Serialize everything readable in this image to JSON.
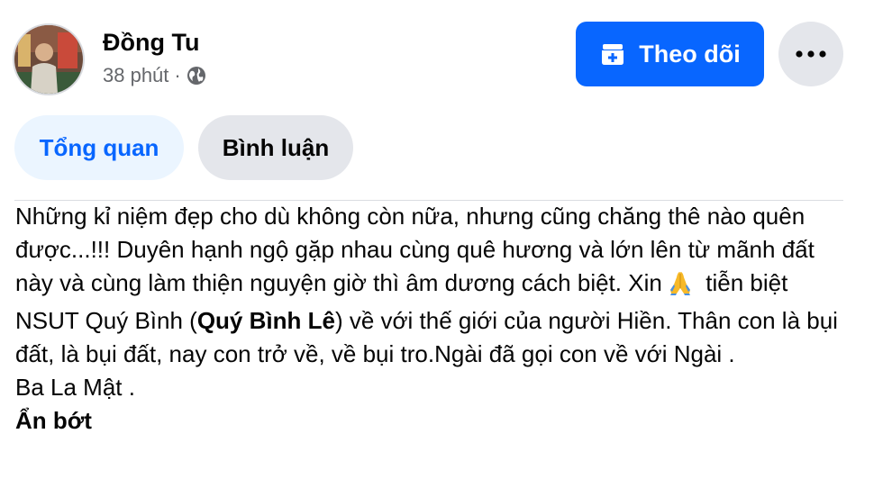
{
  "author": {
    "name": "Đồng Tu",
    "time": "38 phút",
    "separator": "·",
    "privacy_icon": "globe-icon"
  },
  "actions": {
    "follow_label": "Theo dõi",
    "follow_icon": "add-friend-icon",
    "more_icon": "more-horizontal-icon"
  },
  "tabs": [
    {
      "label": "Tổng quan",
      "active": true
    },
    {
      "label": "Bình luận",
      "active": false
    }
  ],
  "post": {
    "paragraph1_part1": "Những kỉ niệm đẹp cho dù không còn nữa, nhưng cũng chăng thê nào quên được...!!! Duyên hạnh ngộ gặp nhau cùng quê hương và lớn lên từ mãnh đất này và cùng làm thiện nguyện giờ thì âm dương cách biệt. Xin",
    "emoji": "folded-hands-emoji",
    "paragraph1_part2": " tiễn biệt NSUT Quý Bình (",
    "mention": "Quý Bình Lê",
    "paragraph1_part3": ") về với thế giới của người Hiền. Thân con là bụi đất, là bụi đất, nay con trở về, về bụi tro.Ngài đã gọi con về với Ngài .",
    "paragraph2": "Ba La Mật .",
    "see_less": "Ẩn bớt"
  },
  "colors": {
    "primary_blue": "#0866ff",
    "tab_active_bg": "#ebf5ff",
    "secondary_bg": "#e4e6eb",
    "secondary_text": "#65676b"
  }
}
